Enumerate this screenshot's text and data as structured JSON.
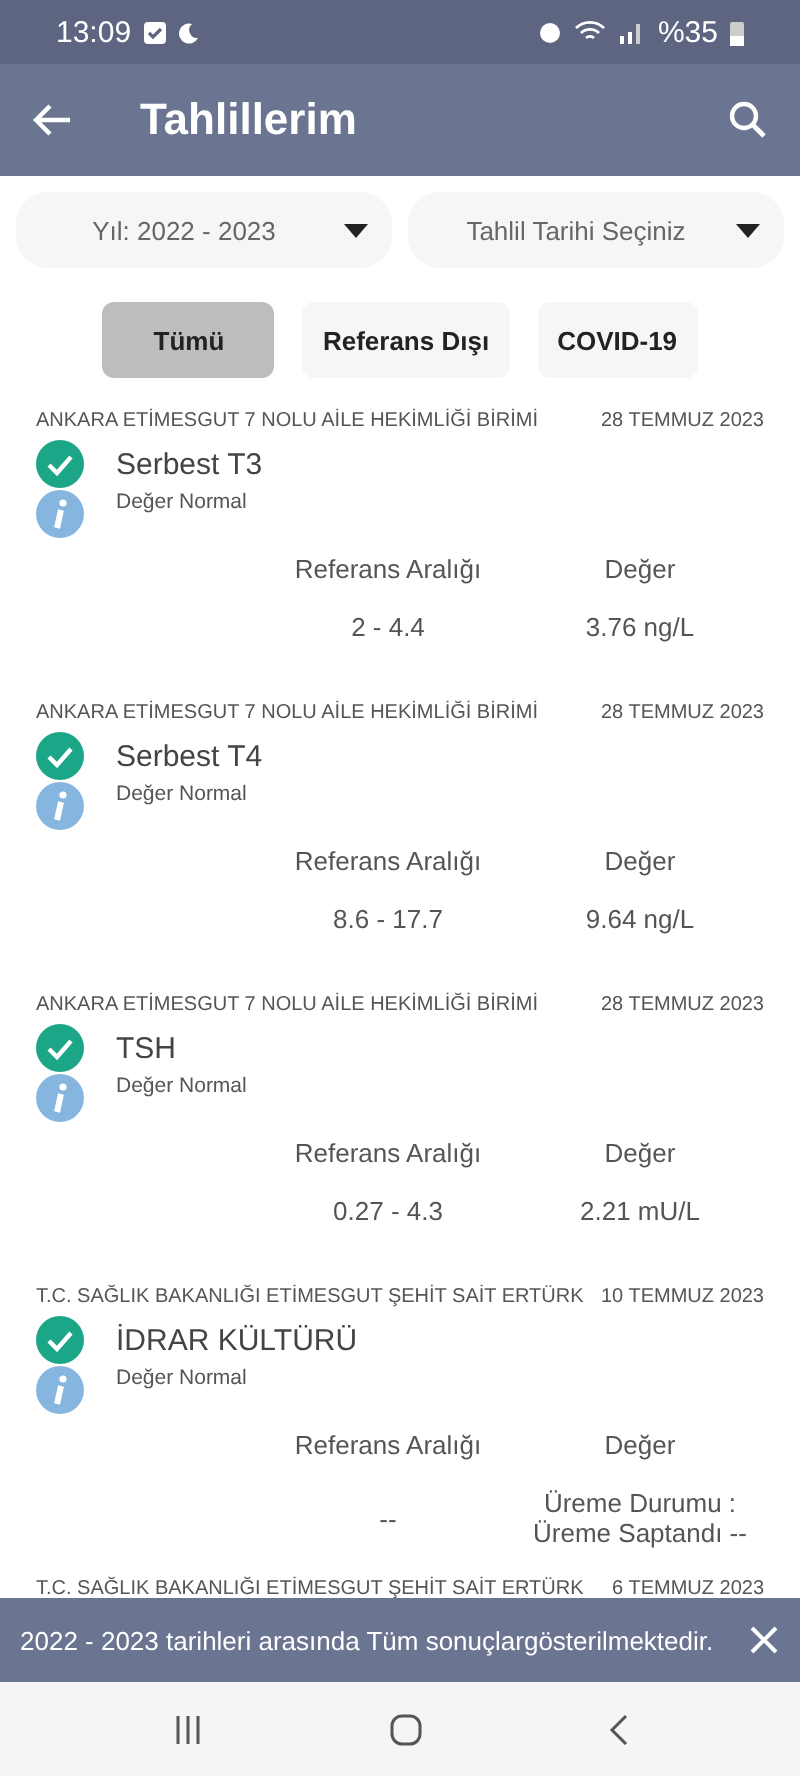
{
  "status_bar": {
    "time": "13:09",
    "battery": "%35"
  },
  "app_bar": {
    "title": "Tahlillerim"
  },
  "filters": [
    {
      "label": "Yıl: 2022 - 2023"
    },
    {
      "label": "Tahlil Tarihi Seçiniz"
    }
  ],
  "chips": [
    {
      "label": "Tümü",
      "selected": true
    },
    {
      "label": "Referans Dışı",
      "selected": false
    },
    {
      "label": "COVID-19",
      "selected": false
    }
  ],
  "results": [
    {
      "hospital": "ANKARA ETİMESGUT 7 NOLU AİLE HEKİMLİĞİ BİRİMİ",
      "date": "28 TEMMUZ 2023",
      "name": "Serbest T3",
      "status": "Değer Normal",
      "range_label": "Referans Aralığı",
      "value_label": "Değer",
      "range": "2 - 4.4",
      "value": "3.76 ng/L"
    },
    {
      "hospital": "ANKARA ETİMESGUT 7 NOLU AİLE HEKİMLİĞİ BİRİMİ",
      "date": "28 TEMMUZ 2023",
      "name": "Serbest T4",
      "status": "Değer Normal",
      "range_label": "Referans Aralığı",
      "value_label": "Değer",
      "range": "8.6 - 17.7",
      "value": "9.64 ng/L"
    },
    {
      "hospital": "ANKARA ETİMESGUT 7 NOLU AİLE HEKİMLİĞİ BİRİMİ",
      "date": "28 TEMMUZ 2023",
      "name": "TSH",
      "status": "Değer Normal",
      "range_label": "Referans Aralığı",
      "value_label": "Değer",
      "range": "0.27 - 4.3",
      "value": "2.21 mU/L"
    },
    {
      "hospital": "T.C. SAĞLIK BAKANLIĞI ETİMESGUT ŞEHİT SAİT ERTÜRK",
      "date": "10 TEMMUZ 2023",
      "name": "İDRAR KÜLTÜRÜ",
      "status": "Değer Normal",
      "range_label": "Referans Aralığı",
      "value_label": "Değer",
      "range": "--",
      "value": "Üreme Durumu :\nÜreme Saptandı --"
    },
    {
      "hospital": "T.C. SAĞLIK BAKANLIĞI ETİMESGUT ŞEHİT SAİT ERTÜRK",
      "date": "6 TEMMUZ 2023"
    }
  ],
  "snackbar": {
    "message": "2022 - 2023 tarihleri arasında Tüm sonuçlargösterilmektedir."
  }
}
